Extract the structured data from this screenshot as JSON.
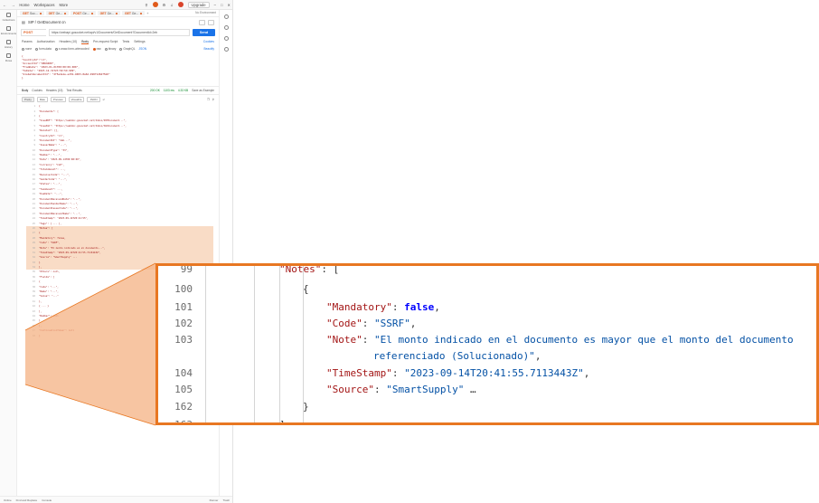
{
  "titlebar": {
    "home": "Home",
    "workspaces": "Workspaces",
    "more": "More",
    "upgrade": "Upgrade",
    "environment": "No Environment"
  },
  "sidebar": {
    "items": [
      {
        "label": "Collections"
      },
      {
        "label": "Environments"
      },
      {
        "label": "History"
      },
      {
        "label": "Flows"
      }
    ]
  },
  "tabs": [
    {
      "method": "GET",
      "label": "Soc..."
    },
    {
      "method": "GET",
      "label": "Ge..."
    },
    {
      "method": "POST",
      "label": "Ge..."
    },
    {
      "method": "GET",
      "label": "Ge..."
    },
    {
      "method": "GET",
      "label": "Ge..."
    }
  ],
  "breadcrumb": {
    "text": "SIP / GetDocument cn"
  },
  "request": {
    "method": "POST",
    "url": "https://webapi.gosocket.net/api/v1/Document/GetDocument?DocumentId=2eb",
    "send_label": "Send",
    "tabs": [
      "Params",
      "Authorization",
      "Headers (10)",
      "Body",
      "Pre-request Script",
      "Tests",
      "Settings"
    ],
    "active_tab": "Body",
    "cookies_label": "Cookies",
    "beautify_label": "Beautify",
    "body_types": [
      "none",
      "form-data",
      "x-www-form-urlencoded",
      "raw",
      "binary",
      "GraphQL"
    ],
    "body_format": "JSON",
    "body_lines": [
      "{",
      "  \"CountryId\":\"cl\",",
      "  \"AccountId\":\"9869480\",",
      "  \"FromDate\": \"2023-01-01T00:00:00.000\",",
      "  \"ToDate\": \"2023-12-31T23:59:59.999\",",
      "  \"GlobalDocumentId\": \"2f5a4a1e-e23b-4003-8a6d-498f1d62f5b0\"",
      "}"
    ]
  },
  "response": {
    "tabs": [
      "Body",
      "Cookies",
      "Headers (15)",
      "Test Results"
    ],
    "status": "200 OK",
    "time": "1103 ms",
    "size": "4.33 KB",
    "save_label": "Save as Example",
    "view_modes": [
      "Pretty",
      "Raw",
      "Preview",
      "Visualize"
    ],
    "format": "JSON",
    "lines": [
      {
        "n": "1",
        "t": "{"
      },
      {
        "n": "2",
        "t": "  \"Documents\": ["
      },
      {
        "n": "3",
        "t": "    {"
      },
      {
        "n": "4",
        "t": "      \"ViewPDF\": \"https://webdoc.gosocket.net/Inbox/PdfDocument...\","
      },
      {
        "n": "5",
        "t": "      \"ViewXml\": \"https://webdoc.gosocket.net/Inbox/XmlDocument...\","
      },
      {
        "n": "6",
        "t": "      \"Related\": [],"
      },
      {
        "n": "7",
        "t": "      \"CountryId\": \"cl\","
      },
      {
        "n": "8",
        "t": "      \"DocumentId\": \"2eb...\","
      },
      {
        "n": "9",
        "t": "      \"IssuerName\": \"...\","
      },
      {
        "n": "10",
        "t": "      \"DocumentType\": \"33\","
      },
      {
        "n": "11",
        "t": "      \"Number\": \"...\","
      },
      {
        "n": "12",
        "t": "      \"Date\": \"2023-09-14T00:00:00\","
      },
      {
        "n": "13",
        "t": "      \"Currency\": \"CLP\","
      },
      {
        "n": "14",
        "t": "      \"TotalAmount\": ...,"
      },
      {
        "n": "15",
        "t": "      \"ReceiverCode\": \"...\","
      },
      {
        "n": "16",
        "t": "      \"SenderCode\": \"...\","
      },
      {
        "n": "17",
        "t": "      \"Status\": \"...\","
      },
      {
        "n": "18",
        "t": "      \"TaxAmount\": ...,"
      },
      {
        "n": "19",
        "t": "      \"DueDate\": \"...\","
      },
      {
        "n": "20",
        "t": "      \"DocumentReceivedDate\": \"...\","
      },
      {
        "n": "21",
        "t": "      \"DocumentSenderName\": \"...\","
      },
      {
        "n": "22",
        "t": "      \"DocumentIssuerCode\": \"...\","
      },
      {
        "n": "23",
        "t": "      \"DocumentReceiverName\": \"...\","
      },
      {
        "n": "24",
        "t": "      \"TimeStamp\": \"2023-09-14T20:41:55\","
      },
      {
        "n": "25",
        "t": "      \"Tags\": [ ... ],"
      },
      {
        "n": "26",
        "t": "      \"Notes\": ["
      },
      {
        "n": "27",
        "t": "        {"
      },
      {
        "n": "28",
        "t": "          \"Mandatory\": false,"
      },
      {
        "n": "29",
        "t": "          \"Code\": \"SSRF\","
      },
      {
        "n": "30",
        "t": "          \"Note\": \"El monto indicado en el documento...\","
      },
      {
        "n": "31",
        "t": "          \"TimeStamp\": \"2023-09-14T20:41:55.7113443Z\","
      },
      {
        "n": "32",
        "t": "          \"Source\": \"SmartSupply\" ..."
      },
      {
        "n": "33",
        "t": "        }"
      },
      {
        "n": "34",
        "t": "      ],"
      },
      {
        "n": "35",
        "t": "      \"Others\": null,"
      },
      {
        "n": "36",
        "t": "      \"Fields\": ["
      },
      {
        "n": "37",
        "t": "        {"
      },
      {
        "n": "38",
        "t": "          \"Code\": \"...\","
      },
      {
        "n": "39",
        "t": "          \"Name\": \"...\","
      },
      {
        "n": "40",
        "t": "          \"Value\": \"...\""
      },
      {
        "n": "41",
        "t": "        },"
      },
      {
        "n": "42",
        "t": "        { ... }"
      },
      {
        "n": "43",
        "t": "      ],"
      },
      {
        "n": "44",
        "t": "      \"Number\": null"
      },
      {
        "n": "45",
        "t": "    }"
      },
      {
        "n": "46",
        "t": "  ],"
      },
      {
        "n": "47",
        "t": "  \"ContinuationToken\": null"
      },
      {
        "n": "48",
        "t": "}"
      }
    ]
  },
  "statusbar": {
    "items": [
      "Online",
      "Find and Replace",
      "Console",
      "Runner",
      "Trash"
    ]
  },
  "zoom": {
    "lines": [
      {
        "n": "99",
        "indent": 1,
        "parts": [
          {
            "c": "k",
            "t": "\"Notes\""
          },
          {
            "c": "p",
            "t": ": ["
          }
        ]
      },
      {
        "n": "100",
        "indent": 2,
        "parts": [
          {
            "c": "p",
            "t": "{"
          }
        ]
      },
      {
        "n": "101",
        "indent": 3,
        "parts": [
          {
            "c": "k",
            "t": "\"Mandatory\""
          },
          {
            "c": "p",
            "t": ": "
          },
          {
            "c": "b",
            "t": "false"
          },
          {
            "c": "p",
            "t": ","
          }
        ]
      },
      {
        "n": "102",
        "indent": 3,
        "parts": [
          {
            "c": "k",
            "t": "\"Code\""
          },
          {
            "c": "p",
            "t": ": "
          },
          {
            "c": "s",
            "t": "\"SSRF\""
          },
          {
            "c": "p",
            "t": ","
          }
        ]
      },
      {
        "n": "103",
        "indent": 3,
        "parts": [
          {
            "c": "k",
            "t": "\"Note\""
          },
          {
            "c": "p",
            "t": ": "
          },
          {
            "c": "s",
            "t": "\"El monto indicado en el documento es mayor que el monto del documento"
          }
        ]
      },
      {
        "n": "",
        "indent": 4,
        "parts": [
          {
            "c": "s",
            "t": "referenciado (Solucionado)\""
          },
          {
            "c": "p",
            "t": ","
          }
        ]
      },
      {
        "n": "104",
        "indent": 3,
        "parts": [
          {
            "c": "k",
            "t": "\"TimeStamp\""
          },
          {
            "c": "p",
            "t": ": "
          },
          {
            "c": "s",
            "t": "\"2023-09-14T20:41:55.7113443Z\""
          },
          {
            "c": "p",
            "t": ","
          }
        ]
      },
      {
        "n": "105",
        "indent": 3,
        "parts": [
          {
            "c": "k",
            "t": "\"Source\""
          },
          {
            "c": "p",
            "t": ": "
          },
          {
            "c": "s",
            "t": "\"SmartSupply\""
          },
          {
            "c": "p",
            "t": " …"
          }
        ]
      },
      {
        "n": "162",
        "indent": 2,
        "parts": [
          {
            "c": "p",
            "t": "}"
          }
        ]
      },
      {
        "n": "163",
        "indent": 1,
        "parts": [
          {
            "c": "p",
            "t": "],"
          }
        ]
      }
    ]
  },
  "colors": {
    "accent": "#e87722",
    "brand_orange": "#e05a1a",
    "send_blue": "#1a73e8",
    "key": "#a31515",
    "string": "#0451a5",
    "boolean": "#0000ff"
  }
}
